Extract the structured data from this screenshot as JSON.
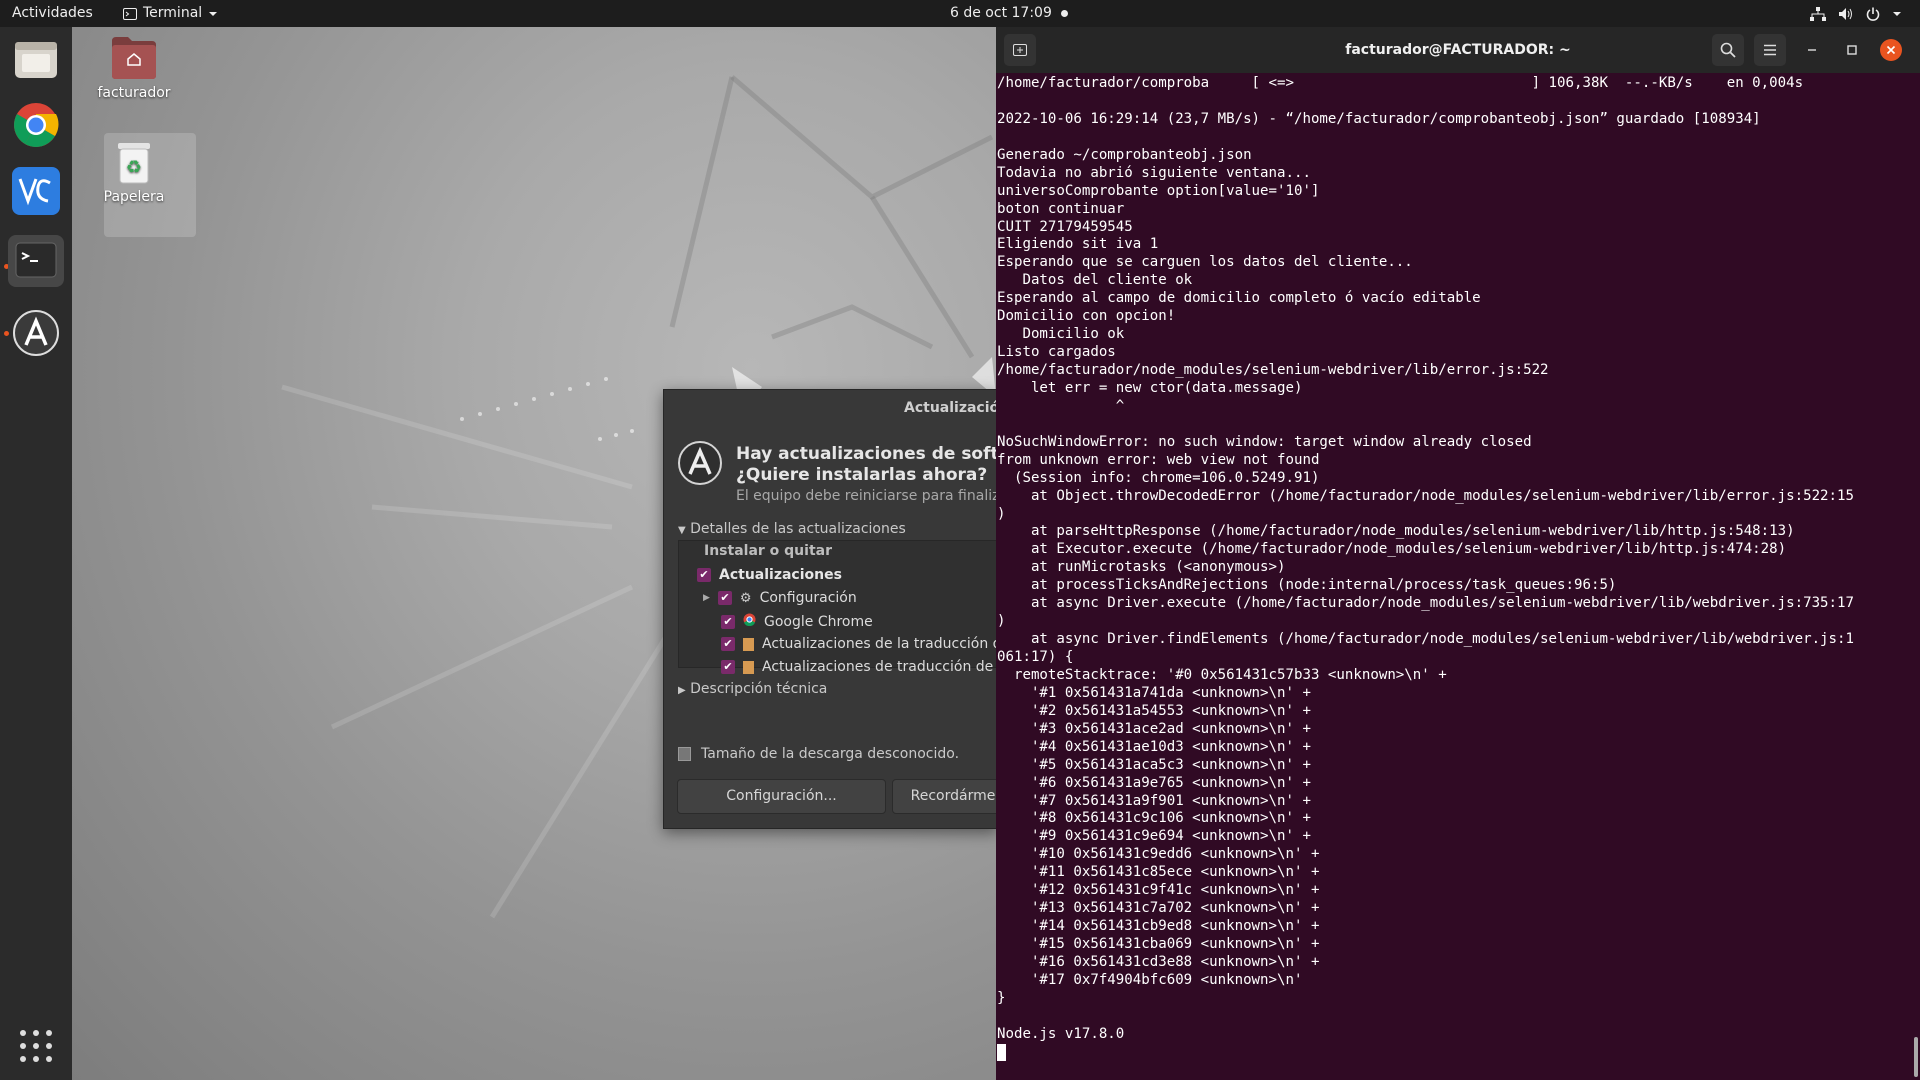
{
  "topbar": {
    "activities": "Actividades",
    "app_menu": "Terminal",
    "clock": "6 de oct  17:09"
  },
  "desktop": {
    "home_icon_label": "facturador",
    "trash_icon_label": "Papelera"
  },
  "dock": {
    "apps": [
      "files-icon",
      "chrome-icon",
      "vscode-icon",
      "terminal-icon",
      "software-updater-icon"
    ]
  },
  "update_dialog": {
    "title": "Actualización",
    "headline_1": "Hay actualizaciones de softwar",
    "headline_2": "¿Quiere instalarlas ahora?",
    "subtitle": "El equipo debe reiniciarse para finaliz",
    "details_toggle": "Detalles de las actualizaciones",
    "tree_header": "Instalar o quitar",
    "group": "Actualizaciones",
    "items": [
      "Configuración",
      "Google Chrome",
      "Actualizaciones de la traducción de",
      "Actualizaciones de traducción de G"
    ],
    "tech_toggle": "Descripción técnica",
    "download_size": "Tamaño de la descarga desconocido.",
    "settings_button": "Configuración...",
    "remind_button": "Recordárme"
  },
  "terminal": {
    "title": "facturador@FACTURADOR: ~",
    "lines": [
      "/home/facturador/comproba     [ <=>                            ] 106,38K  --.-KB/s    en 0,004s",
      "",
      "2022-10-06 16:29:14 (23,7 MB/s) - “/home/facturador/comprobanteobj.json” guardado [108934]",
      "",
      "Generado ~/comprobanteobj.json",
      "Todavia no abrió siguiente ventana...",
      "universoComprobante option[value='10']",
      "boton continuar",
      "CUIT 27179459545",
      "Eligiendo sit iva 1",
      "Esperando que se carguen los datos del cliente...",
      "   Datos del cliente ok",
      "Esperando al campo de domicilio completo ó vacío editable",
      "Domicilio con opcion!",
      "   Domicilio ok",
      "Listo cargados",
      "/home/facturador/node_modules/selenium-webdriver/lib/error.js:522",
      "    let err = new ctor(data.message)",
      "              ^",
      "",
      "NoSuchWindowError: no such window: target window already closed",
      "from unknown error: web view not found",
      "  (Session info: chrome=106.0.5249.91)",
      "    at Object.throwDecodedError (/home/facturador/node_modules/selenium-webdriver/lib/error.js:522:15",
      ")",
      "    at parseHttpResponse (/home/facturador/node_modules/selenium-webdriver/lib/http.js:548:13)",
      "    at Executor.execute (/home/facturador/node_modules/selenium-webdriver/lib/http.js:474:28)",
      "    at runMicrotasks (<anonymous>)",
      "    at processTicksAndRejections (node:internal/process/task_queues:96:5)",
      "    at async Driver.execute (/home/facturador/node_modules/selenium-webdriver/lib/webdriver.js:735:17",
      ")",
      "    at async Driver.findElements (/home/facturador/node_modules/selenium-webdriver/lib/webdriver.js:1",
      "061:17) {",
      "  remoteStacktrace: '#0 0x561431c57b33 <unknown>\\n' +",
      "    '#1 0x561431a741da <unknown>\\n' +",
      "    '#2 0x561431a54553 <unknown>\\n' +",
      "    '#3 0x561431ace2ad <unknown>\\n' +",
      "    '#4 0x561431ae10d3 <unknown>\\n' +",
      "    '#5 0x561431aca5c3 <unknown>\\n' +",
      "    '#6 0x561431a9e765 <unknown>\\n' +",
      "    '#7 0x561431a9f901 <unknown>\\n' +",
      "    '#8 0x561431c9c106 <unknown>\\n' +",
      "    '#9 0x561431c9e694 <unknown>\\n' +",
      "    '#10 0x561431c9edd6 <unknown>\\n' +",
      "    '#11 0x561431c85ece <unknown>\\n' +",
      "    '#12 0x561431c9f41c <unknown>\\n' +",
      "    '#13 0x561431c7a702 <unknown>\\n' +",
      "    '#14 0x561431cb9ed8 <unknown>\\n' +",
      "    '#15 0x561431cba069 <unknown>\\n' +",
      "    '#16 0x561431cd3e88 <unknown>\\n' +",
      "    '#17 0x7f4904bfc609 <unknown>\\n'",
      "}",
      "",
      "Node.js v17.8.0"
    ]
  },
  "colors": {
    "terminal_bg": "#300a24",
    "accent_checkbox": "#7a2a6a",
    "close_button": "#e95420",
    "topbar_bg": "#1d1d1d",
    "dock_bg": "#2b2b2b"
  }
}
